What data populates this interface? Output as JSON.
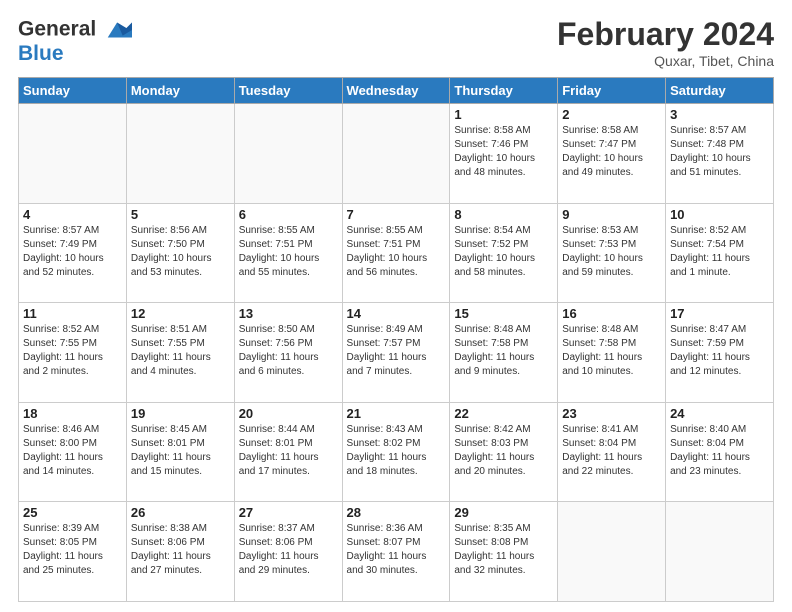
{
  "logo": {
    "line1": "General",
    "line2": "Blue"
  },
  "title": "February 2024",
  "subtitle": "Quxar, Tibet, China",
  "days_of_week": [
    "Sunday",
    "Monday",
    "Tuesday",
    "Wednesday",
    "Thursday",
    "Friday",
    "Saturday"
  ],
  "weeks": [
    [
      {
        "day": "",
        "info": ""
      },
      {
        "day": "",
        "info": ""
      },
      {
        "day": "",
        "info": ""
      },
      {
        "day": "",
        "info": ""
      },
      {
        "day": "1",
        "info": "Sunrise: 8:58 AM\nSunset: 7:46 PM\nDaylight: 10 hours\nand 48 minutes."
      },
      {
        "day": "2",
        "info": "Sunrise: 8:58 AM\nSunset: 7:47 PM\nDaylight: 10 hours\nand 49 minutes."
      },
      {
        "day": "3",
        "info": "Sunrise: 8:57 AM\nSunset: 7:48 PM\nDaylight: 10 hours\nand 51 minutes."
      }
    ],
    [
      {
        "day": "4",
        "info": "Sunrise: 8:57 AM\nSunset: 7:49 PM\nDaylight: 10 hours\nand 52 minutes."
      },
      {
        "day": "5",
        "info": "Sunrise: 8:56 AM\nSunset: 7:50 PM\nDaylight: 10 hours\nand 53 minutes."
      },
      {
        "day": "6",
        "info": "Sunrise: 8:55 AM\nSunset: 7:51 PM\nDaylight: 10 hours\nand 55 minutes."
      },
      {
        "day": "7",
        "info": "Sunrise: 8:55 AM\nSunset: 7:51 PM\nDaylight: 10 hours\nand 56 minutes."
      },
      {
        "day": "8",
        "info": "Sunrise: 8:54 AM\nSunset: 7:52 PM\nDaylight: 10 hours\nand 58 minutes."
      },
      {
        "day": "9",
        "info": "Sunrise: 8:53 AM\nSunset: 7:53 PM\nDaylight: 10 hours\nand 59 minutes."
      },
      {
        "day": "10",
        "info": "Sunrise: 8:52 AM\nSunset: 7:54 PM\nDaylight: 11 hours\nand 1 minute."
      }
    ],
    [
      {
        "day": "11",
        "info": "Sunrise: 8:52 AM\nSunset: 7:55 PM\nDaylight: 11 hours\nand 2 minutes."
      },
      {
        "day": "12",
        "info": "Sunrise: 8:51 AM\nSunset: 7:55 PM\nDaylight: 11 hours\nand 4 minutes."
      },
      {
        "day": "13",
        "info": "Sunrise: 8:50 AM\nSunset: 7:56 PM\nDaylight: 11 hours\nand 6 minutes."
      },
      {
        "day": "14",
        "info": "Sunrise: 8:49 AM\nSunset: 7:57 PM\nDaylight: 11 hours\nand 7 minutes."
      },
      {
        "day": "15",
        "info": "Sunrise: 8:48 AM\nSunset: 7:58 PM\nDaylight: 11 hours\nand 9 minutes."
      },
      {
        "day": "16",
        "info": "Sunrise: 8:48 AM\nSunset: 7:58 PM\nDaylight: 11 hours\nand 10 minutes."
      },
      {
        "day": "17",
        "info": "Sunrise: 8:47 AM\nSunset: 7:59 PM\nDaylight: 11 hours\nand 12 minutes."
      }
    ],
    [
      {
        "day": "18",
        "info": "Sunrise: 8:46 AM\nSunset: 8:00 PM\nDaylight: 11 hours\nand 14 minutes."
      },
      {
        "day": "19",
        "info": "Sunrise: 8:45 AM\nSunset: 8:01 PM\nDaylight: 11 hours\nand 15 minutes."
      },
      {
        "day": "20",
        "info": "Sunrise: 8:44 AM\nSunset: 8:01 PM\nDaylight: 11 hours\nand 17 minutes."
      },
      {
        "day": "21",
        "info": "Sunrise: 8:43 AM\nSunset: 8:02 PM\nDaylight: 11 hours\nand 18 minutes."
      },
      {
        "day": "22",
        "info": "Sunrise: 8:42 AM\nSunset: 8:03 PM\nDaylight: 11 hours\nand 20 minutes."
      },
      {
        "day": "23",
        "info": "Sunrise: 8:41 AM\nSunset: 8:04 PM\nDaylight: 11 hours\nand 22 minutes."
      },
      {
        "day": "24",
        "info": "Sunrise: 8:40 AM\nSunset: 8:04 PM\nDaylight: 11 hours\nand 23 minutes."
      }
    ],
    [
      {
        "day": "25",
        "info": "Sunrise: 8:39 AM\nSunset: 8:05 PM\nDaylight: 11 hours\nand 25 minutes."
      },
      {
        "day": "26",
        "info": "Sunrise: 8:38 AM\nSunset: 8:06 PM\nDaylight: 11 hours\nand 27 minutes."
      },
      {
        "day": "27",
        "info": "Sunrise: 8:37 AM\nSunset: 8:06 PM\nDaylight: 11 hours\nand 29 minutes."
      },
      {
        "day": "28",
        "info": "Sunrise: 8:36 AM\nSunset: 8:07 PM\nDaylight: 11 hours\nand 30 minutes."
      },
      {
        "day": "29",
        "info": "Sunrise: 8:35 AM\nSunset: 8:08 PM\nDaylight: 11 hours\nand 32 minutes."
      },
      {
        "day": "",
        "info": ""
      },
      {
        "day": "",
        "info": ""
      }
    ]
  ]
}
